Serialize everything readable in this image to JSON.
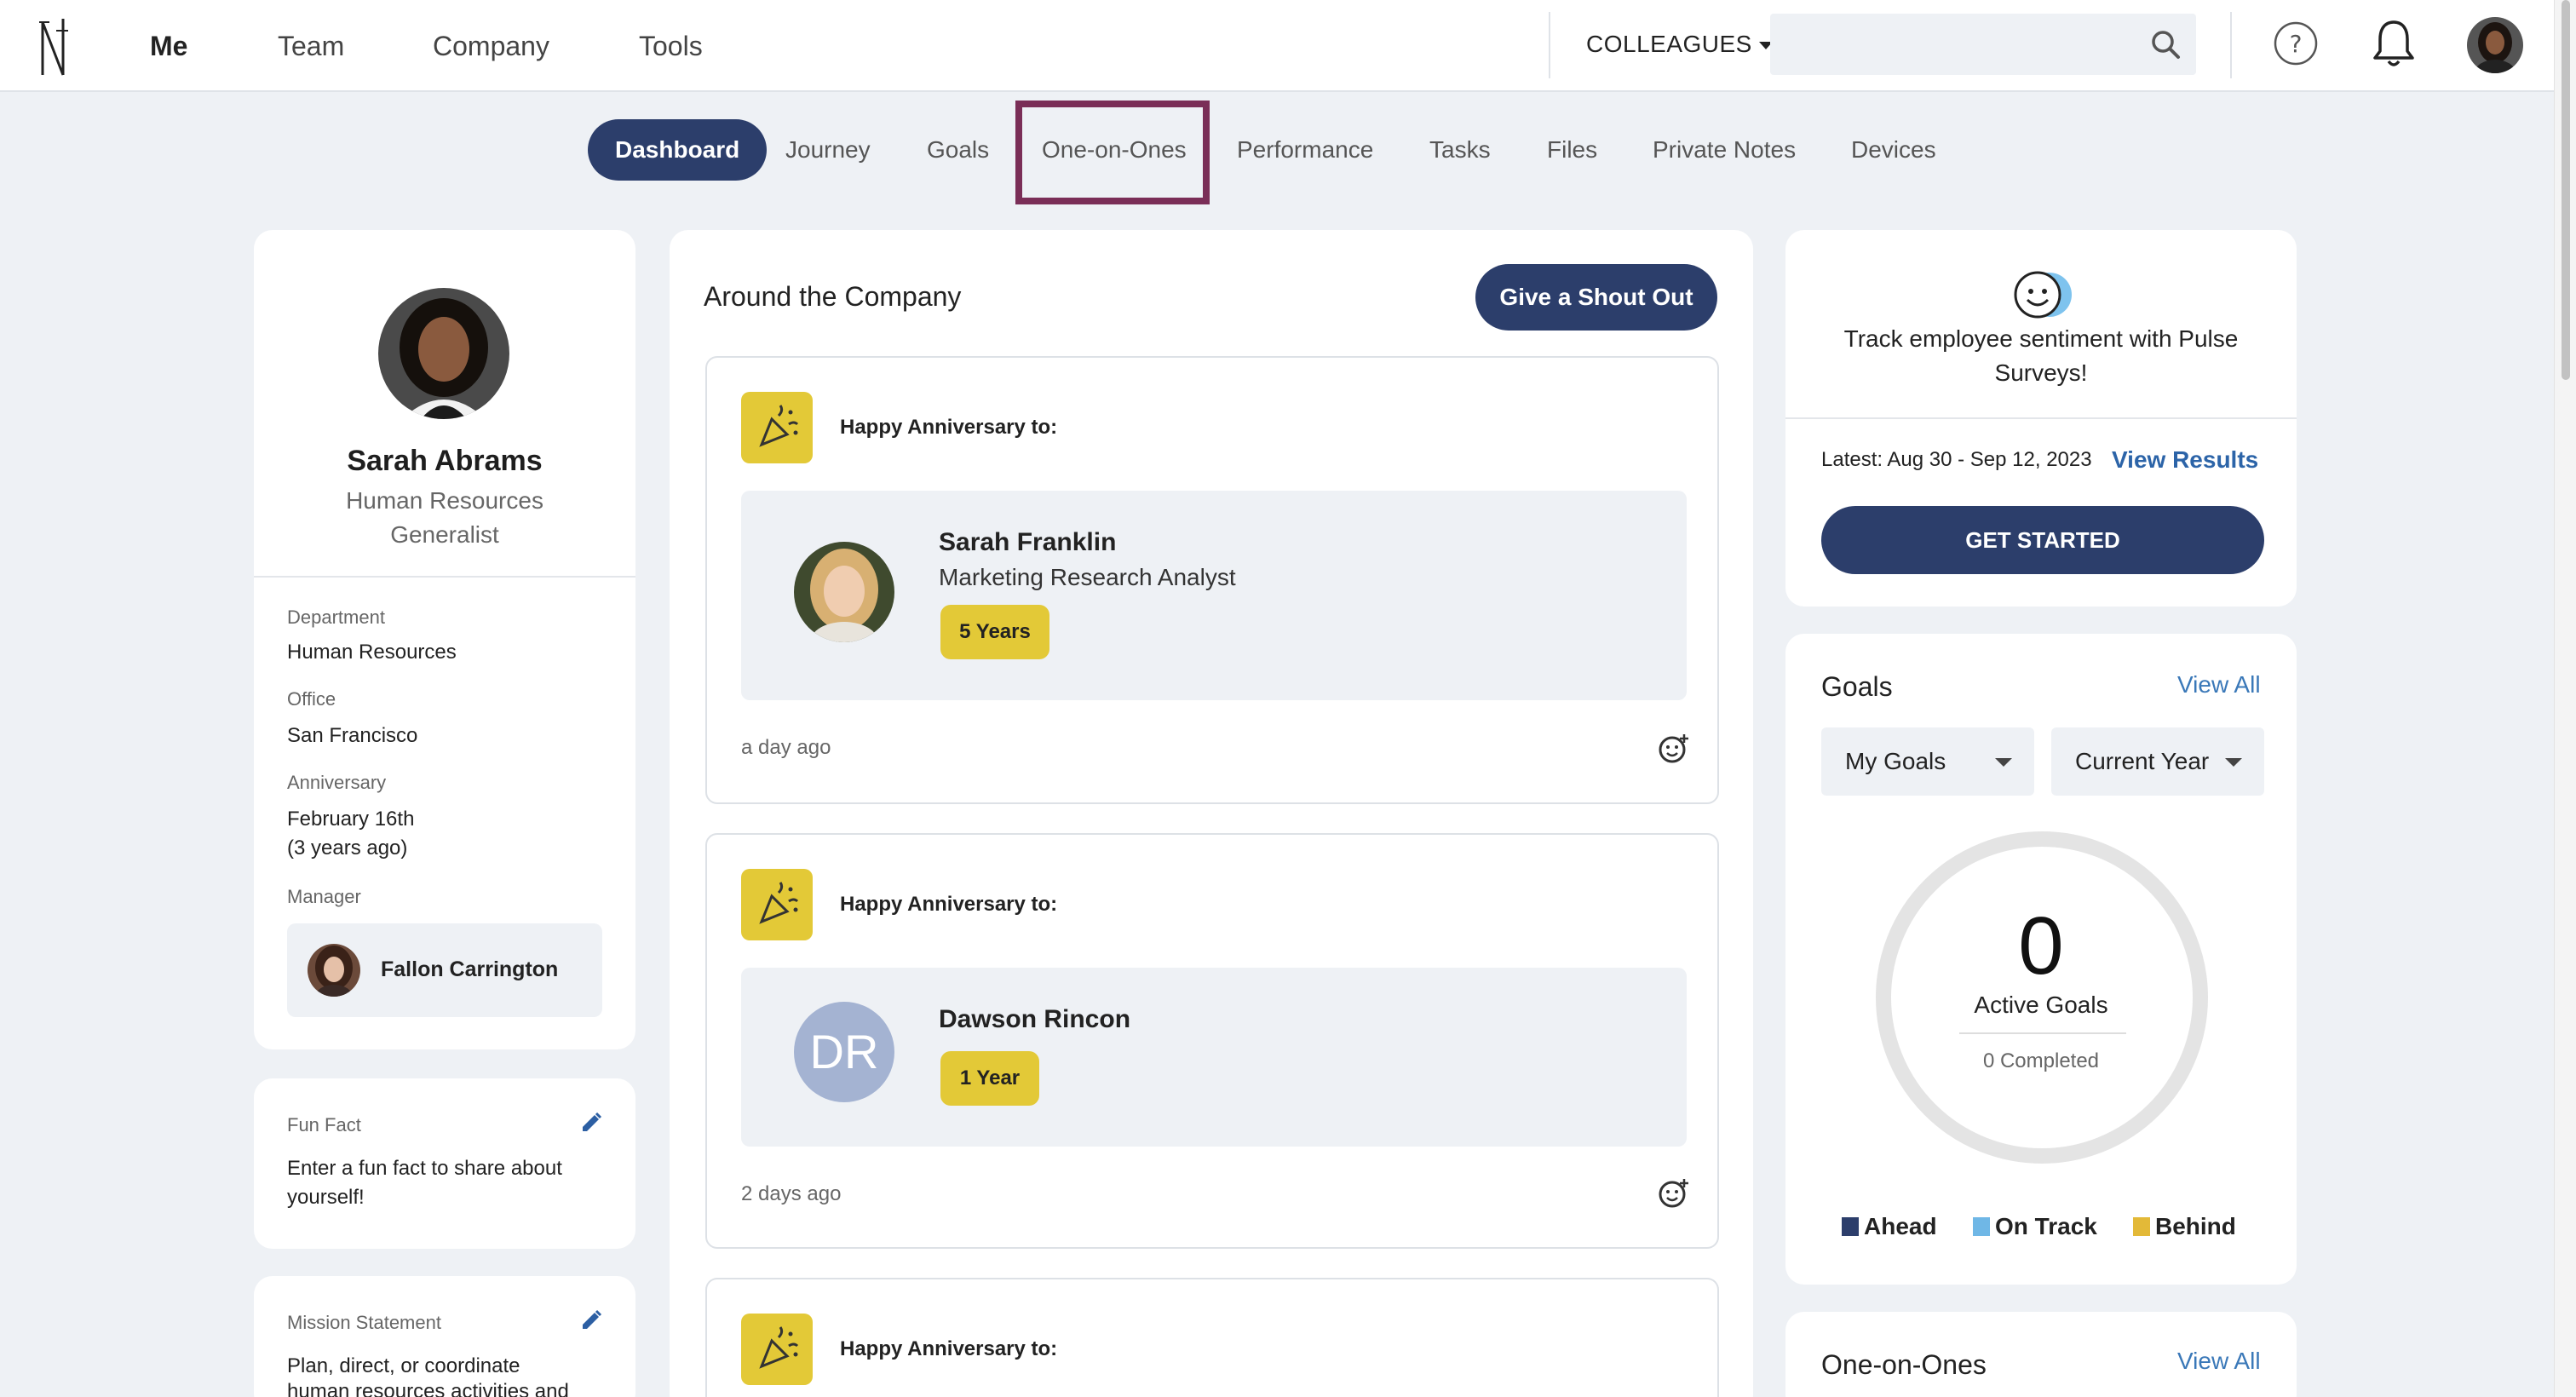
{
  "topnav": {
    "items": [
      "Me",
      "Team",
      "Company",
      "Tools"
    ],
    "colleagues_label": "COLLEAGUES",
    "search_placeholder": ""
  },
  "subnav": {
    "tabs": [
      "Dashboard",
      "Journey",
      "Goals",
      "One-on-Ones",
      "Performance",
      "Tasks",
      "Files",
      "Private Notes",
      "Devices"
    ],
    "active": "Dashboard"
  },
  "profile": {
    "name": "Sarah Abrams",
    "title_line1": "Human Resources",
    "title_line2": "Generalist",
    "department_label": "Department",
    "department": "Human Resources",
    "office_label": "Office",
    "office": "San Francisco",
    "anniversary_label": "Anniversary",
    "anniversary": "February 16th",
    "anniversary_ago": "(3 years ago)",
    "manager_label": "Manager",
    "manager": "Fallon Carrington"
  },
  "fun_fact": {
    "label": "Fun Fact",
    "text_line1": "Enter a fun fact to share about",
    "text_line2": "yourself!"
  },
  "mission": {
    "label": "Mission Statement",
    "text_line1": "Plan, direct, or coordinate",
    "text_line2": "human resources activities and"
  },
  "feed": {
    "title": "Around the Company",
    "shout_out_label": "Give a Shout Out",
    "items": [
      {
        "heading": "Happy Anniversary to:",
        "name": "Sarah Franklin",
        "role": "Marketing Research Analyst",
        "years": "5 Years",
        "time": "a day ago"
      },
      {
        "heading": "Happy Anniversary to:",
        "name": "Dawson Rincon",
        "initials": "DR",
        "years": "1 Year",
        "time": "2 days ago"
      },
      {
        "heading": "Happy Anniversary to:"
      }
    ]
  },
  "pulse": {
    "text_line1": "Track employee sentiment with Pulse",
    "text_line2": "Surveys!",
    "latest": "Latest: Aug 30 - Sep 12, 2023",
    "view_results": "View Results",
    "get_started": "GET STARTED"
  },
  "goals": {
    "title": "Goals",
    "view_all": "View All",
    "filter_owner": "My Goals",
    "filter_period": "Current Year",
    "active_count": "0",
    "active_label": "Active Goals",
    "completed": "0 Completed",
    "legend": [
      {
        "label": "Ahead",
        "color": "#2c3e6b"
      },
      {
        "label": "On Track",
        "color": "#6fb7e6"
      },
      {
        "label": "Behind",
        "color": "#e3b938"
      }
    ]
  },
  "one_on_ones": {
    "title": "One-on-Ones",
    "view_all": "View All"
  },
  "colors": {
    "navy": "#2c3e6b",
    "accent_yellow": "#e3c937",
    "highlight": "#7a2e57",
    "link": "#3a78b8"
  }
}
